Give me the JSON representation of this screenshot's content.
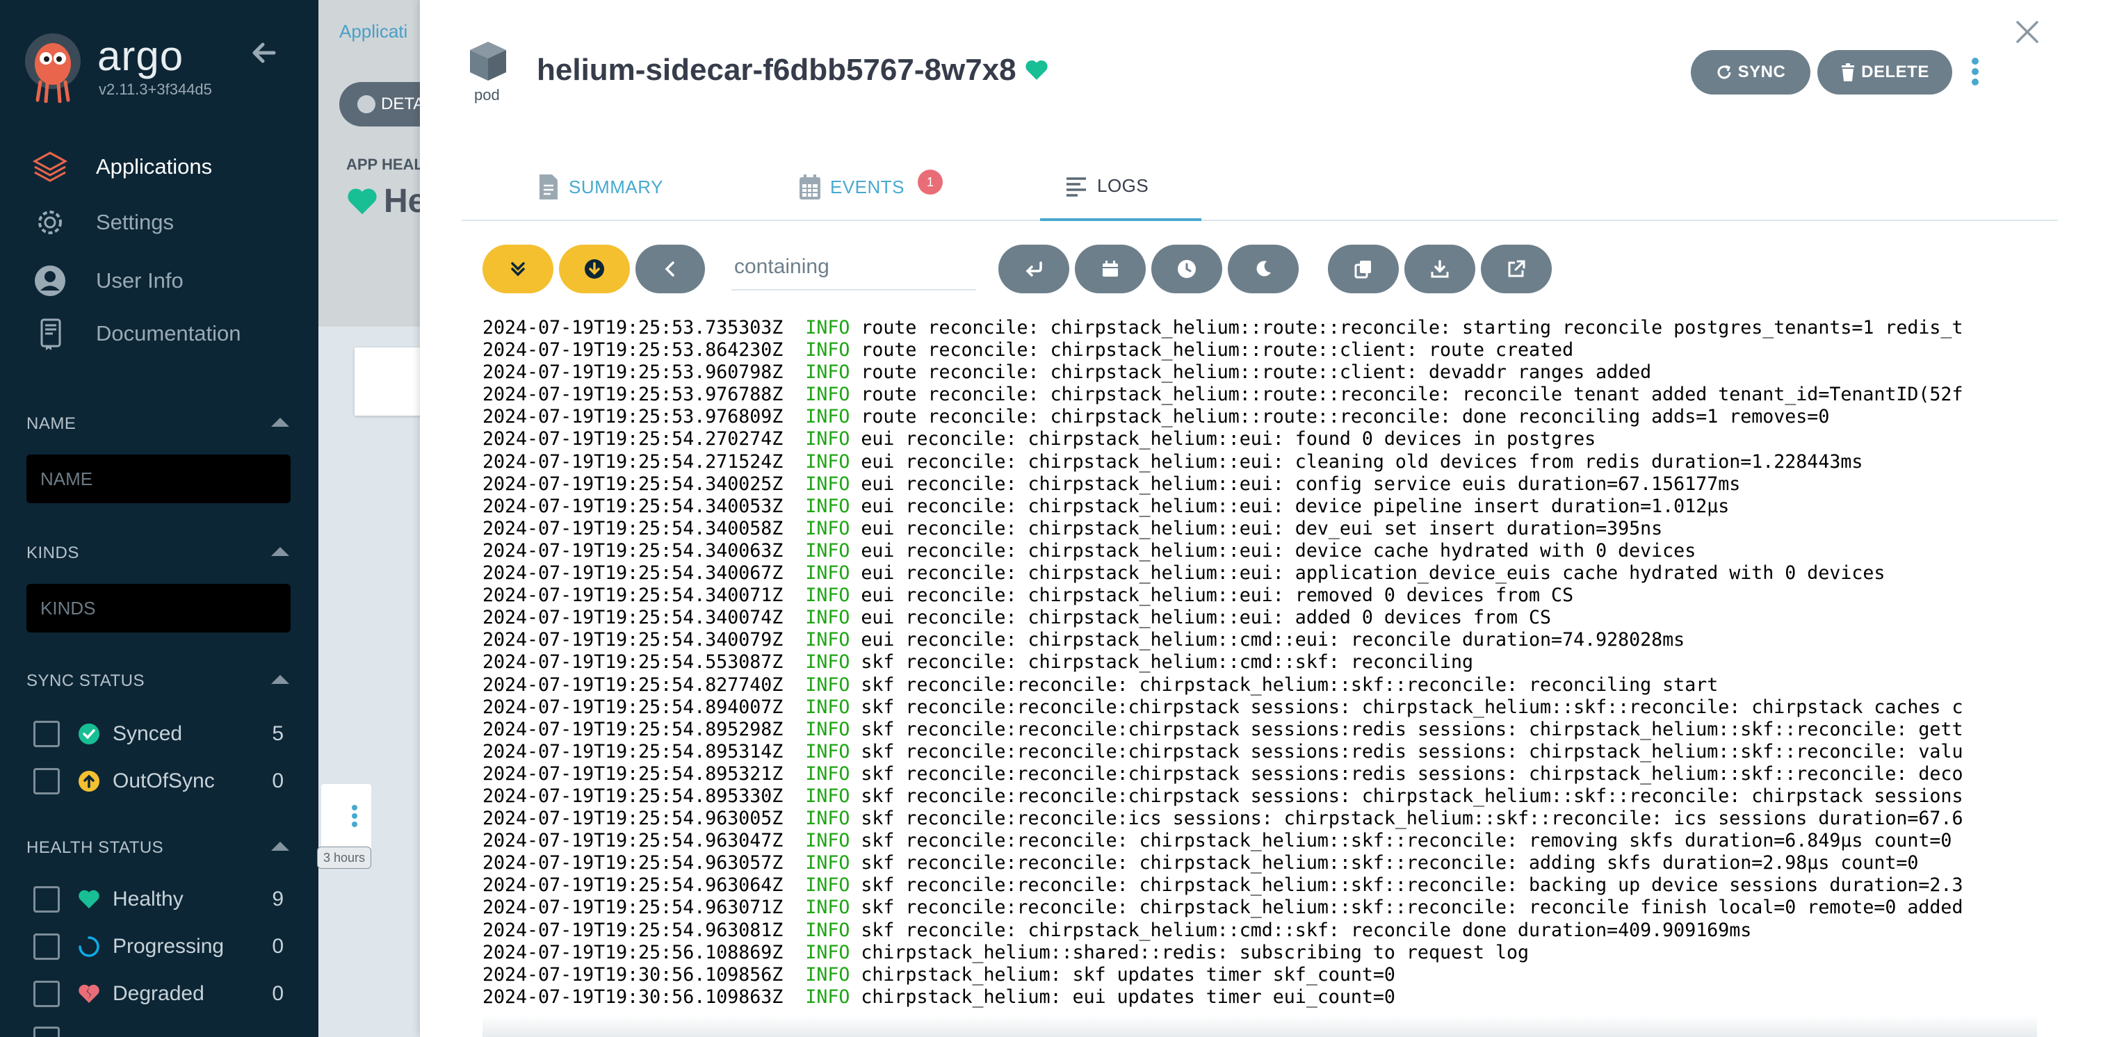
{
  "sidebar": {
    "brand": "argo",
    "version": "v2.11.3+3f344d5",
    "nav": [
      {
        "label": "Applications",
        "icon": "layers-icon",
        "active": true
      },
      {
        "label": "Settings",
        "icon": "gear-icon",
        "active": false
      },
      {
        "label": "User Info",
        "icon": "user-icon",
        "active": false
      },
      {
        "label": "Documentation",
        "icon": "book-icon",
        "active": false
      }
    ],
    "filters": {
      "name": {
        "title": "NAME",
        "placeholder": "NAME"
      },
      "kinds": {
        "title": "KINDS",
        "placeholder": "KINDS"
      },
      "sync_status": {
        "title": "SYNC STATUS",
        "items": [
          {
            "label": "Synced",
            "count": "5",
            "icon": "check-circle-icon",
            "color": "#18be94"
          },
          {
            "label": "OutOfSync",
            "count": "0",
            "icon": "arrow-up-circle-icon",
            "color": "#f4c030"
          }
        ]
      },
      "health_status": {
        "title": "HEALTH STATUS",
        "items": [
          {
            "label": "Healthy",
            "count": "9",
            "icon": "heart-icon",
            "color": "#18be94"
          },
          {
            "label": "Progressing",
            "count": "0",
            "icon": "circle-notch-icon",
            "color": "#0dadea"
          },
          {
            "label": "Degraded",
            "count": "0",
            "icon": "heart-broken-icon",
            "color": "#e96d76"
          }
        ]
      }
    }
  },
  "background": {
    "breadcrumb": "Applicati",
    "details_button": "DETA",
    "app_health_label": "APP HEAL",
    "app_health_value": "He",
    "node_badge": "3 hours"
  },
  "panel": {
    "kind": "pod",
    "title": "helium-sidecar-f6dbb5767-8w7x8",
    "actions": {
      "sync": "SYNC",
      "delete": "DELETE"
    },
    "tabs": [
      {
        "label": "SUMMARY",
        "icon": "file-icon",
        "active": false
      },
      {
        "label": "EVENTS",
        "icon": "calendar-icon",
        "active": false,
        "badge": "1"
      },
      {
        "label": "LOGS",
        "icon": "logs-icon",
        "active": true
      }
    ],
    "log_filter": {
      "placeholder": "containing"
    },
    "log_toolbar": [
      "follow-icon",
      "download-arrow-icon",
      "previous-container-icon",
      "wrap-lines-icon",
      "calendar-timestamp-icon",
      "clock-icon",
      "dark-mode-icon",
      "copy-icon",
      "download-icon",
      "open-new-window-icon"
    ],
    "logs": [
      {
        "ts": "2024-07-19T19:25:53.735303Z",
        "level": "INFO",
        "msg": "route reconcile: chirpstack_helium::route::reconcile: starting reconcile postgres_tenants=1 redis_t"
      },
      {
        "ts": "2024-07-19T19:25:53.864230Z",
        "level": "INFO",
        "msg": "route reconcile: chirpstack_helium::route::client: route created"
      },
      {
        "ts": "2024-07-19T19:25:53.960798Z",
        "level": "INFO",
        "msg": "route reconcile: chirpstack_helium::route::client: devaddr ranges added"
      },
      {
        "ts": "2024-07-19T19:25:53.976788Z",
        "level": "INFO",
        "msg": "route reconcile: chirpstack_helium::route::reconcile: reconcile tenant added tenant_id=TenantID(52f"
      },
      {
        "ts": "2024-07-19T19:25:53.976809Z",
        "level": "INFO",
        "msg": "route reconcile: chirpstack_helium::route::reconcile: done reconciling adds=1 removes=0"
      },
      {
        "ts": "2024-07-19T19:25:54.270274Z",
        "level": "INFO",
        "msg": "eui reconcile: chirpstack_helium::eui: found 0 devices in postgres"
      },
      {
        "ts": "2024-07-19T19:25:54.271524Z",
        "level": "INFO",
        "msg": "eui reconcile: chirpstack_helium::eui: cleaning old devices from redis duration=1.228443ms"
      },
      {
        "ts": "2024-07-19T19:25:54.340025Z",
        "level": "INFO",
        "msg": "eui reconcile: chirpstack_helium::eui: config service euis duration=67.156177ms"
      },
      {
        "ts": "2024-07-19T19:25:54.340053Z",
        "level": "INFO",
        "msg": "eui reconcile: chirpstack_helium::eui: device pipeline insert duration=1.012µs"
      },
      {
        "ts": "2024-07-19T19:25:54.340058Z",
        "level": "INFO",
        "msg": "eui reconcile: chirpstack_helium::eui: dev_eui set insert duration=395ns"
      },
      {
        "ts": "2024-07-19T19:25:54.340063Z",
        "level": "INFO",
        "msg": "eui reconcile: chirpstack_helium::eui: device cache hydrated with 0 devices"
      },
      {
        "ts": "2024-07-19T19:25:54.340067Z",
        "level": "INFO",
        "msg": "eui reconcile: chirpstack_helium::eui: application_device_euis cache hydrated with 0 devices"
      },
      {
        "ts": "2024-07-19T19:25:54.340071Z",
        "level": "INFO",
        "msg": "eui reconcile: chirpstack_helium::eui: removed 0 devices from CS"
      },
      {
        "ts": "2024-07-19T19:25:54.340074Z",
        "level": "INFO",
        "msg": "eui reconcile: chirpstack_helium::eui: added 0 devices from CS"
      },
      {
        "ts": "2024-07-19T19:25:54.340079Z",
        "level": "INFO",
        "msg": "eui reconcile: chirpstack_helium::cmd::eui: reconcile duration=74.928028ms"
      },
      {
        "ts": "2024-07-19T19:25:54.553087Z",
        "level": "INFO",
        "msg": "skf reconcile: chirpstack_helium::cmd::skf: reconciling"
      },
      {
        "ts": "2024-07-19T19:25:54.827740Z",
        "level": "INFO",
        "msg": "skf reconcile:reconcile: chirpstack_helium::skf::reconcile: reconciling start"
      },
      {
        "ts": "2024-07-19T19:25:54.894007Z",
        "level": "INFO",
        "msg": "skf reconcile:reconcile:chirpstack sessions: chirpstack_helium::skf::reconcile: chirpstack caches c"
      },
      {
        "ts": "2024-07-19T19:25:54.895298Z",
        "level": "INFO",
        "msg": "skf reconcile:reconcile:chirpstack sessions:redis sessions: chirpstack_helium::skf::reconcile: gett"
      },
      {
        "ts": "2024-07-19T19:25:54.895314Z",
        "level": "INFO",
        "msg": "skf reconcile:reconcile:chirpstack sessions:redis sessions: chirpstack_helium::skf::reconcile: valu"
      },
      {
        "ts": "2024-07-19T19:25:54.895321Z",
        "level": "INFO",
        "msg": "skf reconcile:reconcile:chirpstack sessions:redis sessions: chirpstack_helium::skf::reconcile: deco"
      },
      {
        "ts": "2024-07-19T19:25:54.895330Z",
        "level": "INFO",
        "msg": "skf reconcile:reconcile:chirpstack sessions: chirpstack_helium::skf::reconcile: chirpstack sessions"
      },
      {
        "ts": "2024-07-19T19:25:54.963005Z",
        "level": "INFO",
        "msg": "skf reconcile:reconcile:ics sessions: chirpstack_helium::skf::reconcile: ics sessions duration=67.6"
      },
      {
        "ts": "2024-07-19T19:25:54.963047Z",
        "level": "INFO",
        "msg": "skf reconcile:reconcile: chirpstack_helium::skf::reconcile: removing skfs duration=6.849µs count=0"
      },
      {
        "ts": "2024-07-19T19:25:54.963057Z",
        "level": "INFO",
        "msg": "skf reconcile:reconcile: chirpstack_helium::skf::reconcile: adding skfs duration=2.98µs count=0"
      },
      {
        "ts": "2024-07-19T19:25:54.963064Z",
        "level": "INFO",
        "msg": "skf reconcile:reconcile: chirpstack_helium::skf::reconcile: backing up device sessions duration=2.3"
      },
      {
        "ts": "2024-07-19T19:25:54.963071Z",
        "level": "INFO",
        "msg": "skf reconcile:reconcile: chirpstack_helium::skf::reconcile: reconcile finish local=0 remote=0 added"
      },
      {
        "ts": "2024-07-19T19:25:54.963081Z",
        "level": "INFO",
        "msg": "skf reconcile: chirpstack_helium::cmd::skf: reconcile done duration=409.909169ms"
      },
      {
        "ts": "2024-07-19T19:25:56.108869Z",
        "level": "INFO",
        "msg": "chirpstack_helium::shared::redis: subscribing to request log"
      },
      {
        "ts": "2024-07-19T19:30:56.109856Z",
        "level": "INFO",
        "msg": "chirpstack_helium: skf updates timer skf_count=0"
      },
      {
        "ts": "2024-07-19T19:30:56.109863Z",
        "level": "INFO",
        "msg": "chirpstack_helium: eui updates timer eui_count=0"
      }
    ]
  },
  "colors": {
    "sidebar_bg": "#0c2636",
    "accent": "#48a9cf",
    "healthy": "#18be94",
    "warning": "#f4c030",
    "danger": "#e96d76",
    "button_gray": "#6d7f8b",
    "log_level_info": "#1fa514"
  }
}
